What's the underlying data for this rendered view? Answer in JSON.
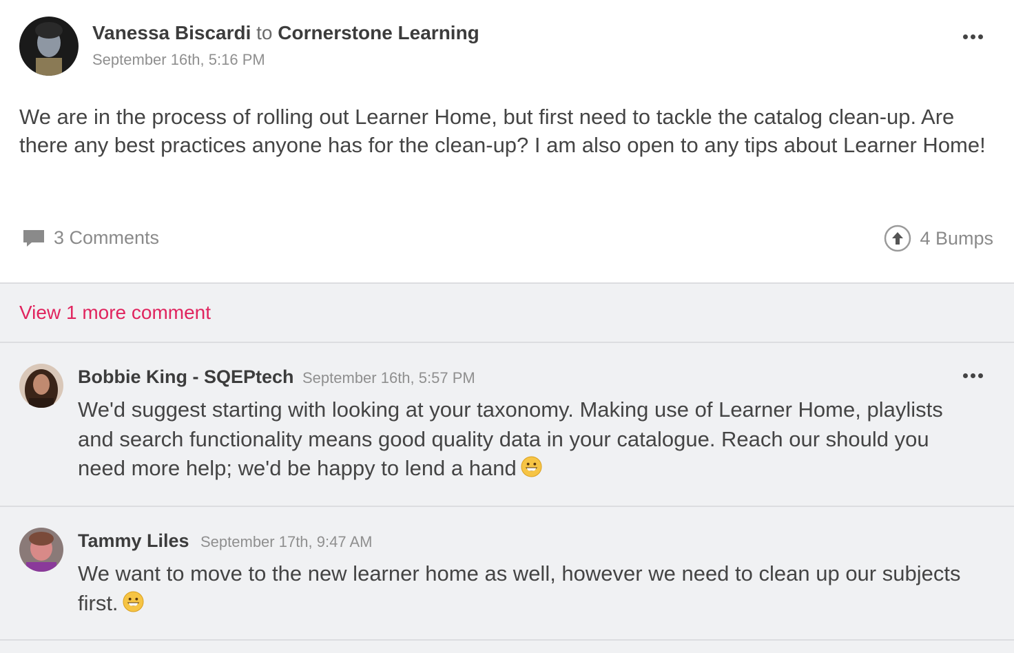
{
  "post": {
    "author": "Vanessa Biscardi",
    "to_word": "to",
    "group": "Cornerstone Learning",
    "timestamp": "September 16th, 5:16 PM",
    "body": "We are in the process of rolling out Learner Home, but first need to tackle the catalog clean-up. Are there any best practices anyone has for the clean-up? I am also open to any tips about Learner Home!",
    "comments_label": "3 Comments",
    "bumps_label": "4 Bumps"
  },
  "comments_section": {
    "view_more_label": "View 1 more comment",
    "comments": [
      {
        "author": "Bobbie King - SQEPtech",
        "timestamp": "September 16th, 5:57 PM",
        "body": "We'd suggest starting with looking at your taxonomy. Making use of Learner Home, playlists and search functionality means good quality data in your catalogue. Reach our should you need more help; we'd be happy to lend a hand"
      },
      {
        "author": "Tammy Liles",
        "timestamp": "September 17th, 9:47 AM",
        "body": "We want to move to the new learner home as well, however we need to clean up our subjects first."
      }
    ]
  },
  "colors": {
    "link": "#e0245e",
    "comments_bg": "#f0f1f3"
  },
  "icons": [
    "comment-icon",
    "bump-arrow-icon",
    "more-options-icon",
    "grinning-emoji-icon"
  ]
}
